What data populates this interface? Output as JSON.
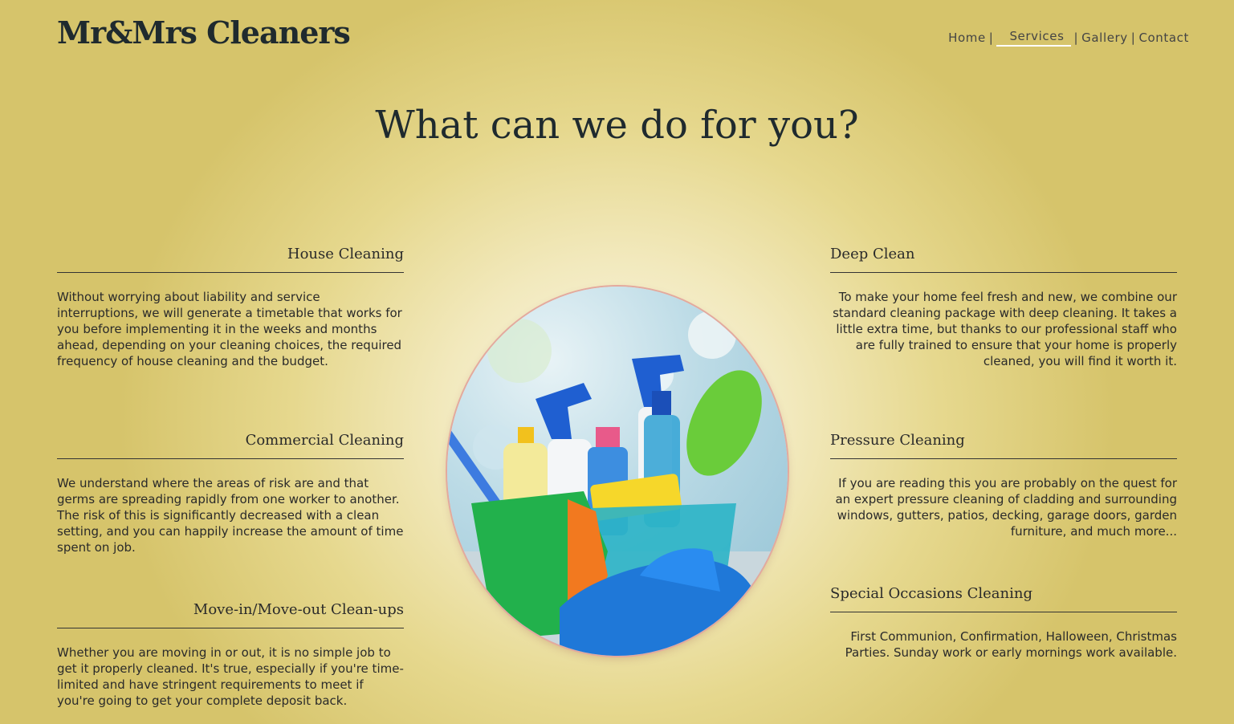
{
  "header": {
    "logo": "Mr&Mrs Cleaners",
    "nav": [
      {
        "label": "Home"
      },
      {
        "label": "Services"
      },
      {
        "label": "Gallery"
      },
      {
        "label": "Contact"
      }
    ],
    "separator": "|",
    "active_item": "Services"
  },
  "main": {
    "headline": "What can we do for you?",
    "image_icon": "cleaning-supplies-image",
    "services_left": [
      {
        "title": "House Cleaning",
        "text": "Without worrying about liability and service interruptions, we will generate a timetable that works for you before implementing it in the weeks and months ahead, depending on your cleaning choices, the required frequency of house cleaning and the budget."
      },
      {
        "title": "Commercial Cleaning",
        "text": "We understand where the areas of risk are and that germs are spreading rapidly from one worker to another. The risk of this is significantly decreased with a clean setting, and you can happily increase the amount of time spent on job."
      },
      {
        "title": "Move-in/Move-out Clean-ups",
        "text": "Whether you are moving in or out, it is no simple job to get it properly cleaned. It's true, especially if you're time-limited and have stringent requirements to meet if you're going to get your complete deposit back."
      }
    ],
    "services_right": [
      {
        "title": "Deep Clean",
        "text": "To make your home feel fresh and new, we combine our standard cleaning package with deep cleaning. It takes a little extra time, but thanks to our professional staff who are fully trained to ensure that your home is properly cleaned, you will find it worth it."
      },
      {
        "title": "Pressure Cleaning",
        "text": "If you are reading this you are probably on the quest for an expert pressure cleaning of cladding and surrounding windows, gutters, patios, decking, garage doors, garden furniture, and much more..."
      },
      {
        "title": "Special Occasions Cleaning",
        "text": "First Communion, Confirmation, Halloween, Christmas Parties. Sunday work or early mornings work available."
      }
    ]
  },
  "colors": {
    "accent_underline": "#ffffff",
    "heading": "#1f2a2e",
    "background_edge": "#d6c46b",
    "background_center": "#fbf8e9"
  }
}
